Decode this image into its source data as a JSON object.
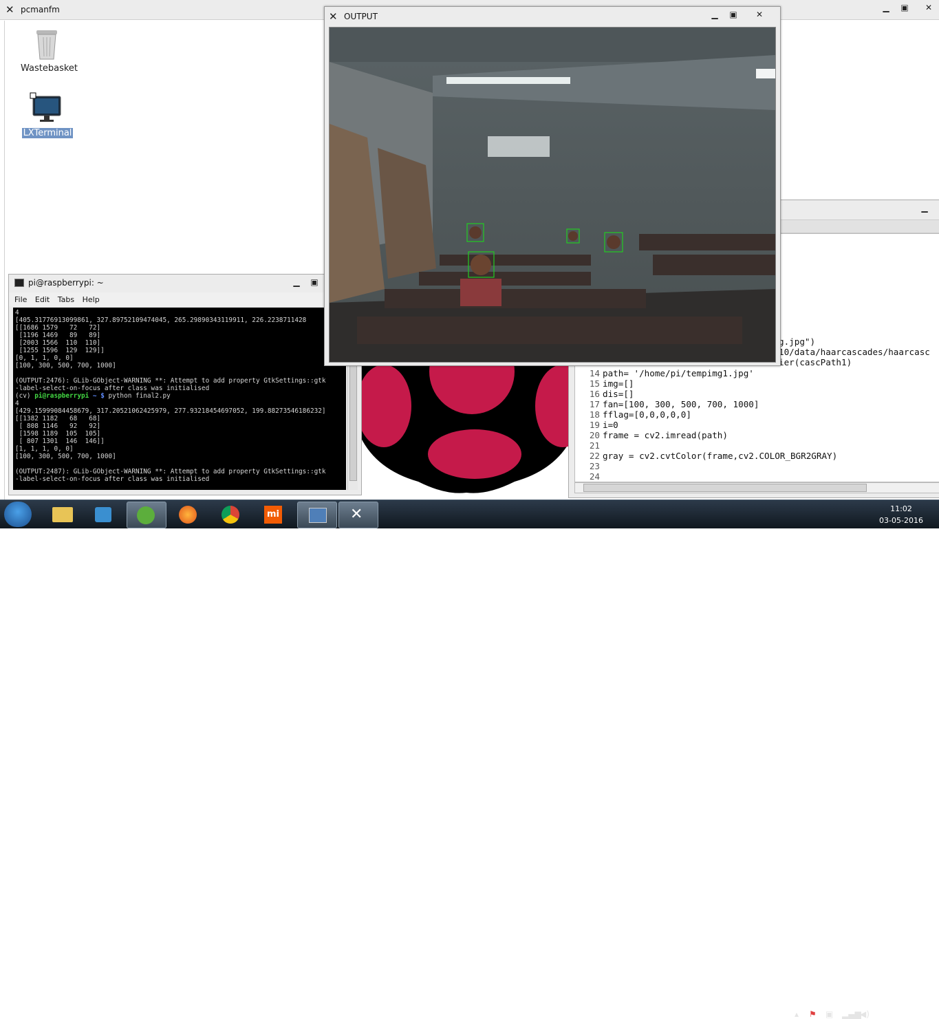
{
  "pcmanfm": {
    "title": "pcmanfm",
    "icons": [
      {
        "label": "Wastebasket"
      },
      {
        "label": "LXTerminal"
      }
    ]
  },
  "terminal": {
    "title": "pi@raspberrypi: ~",
    "menu": [
      "File",
      "Edit",
      "Tabs",
      "Help"
    ],
    "lines": [
      "4",
      "[405.31776913099861, 327.89752109474045, 265.29890343119911, 226.2238711428",
      "[[1686 1579   72   72]",
      " [1196 1469   89   89]",
      " [2003 1566  110  110]",
      " [1255 1596  129  129]]",
      "[0, 1, 1, 0, 0]",
      "[100, 300, 500, 700, 1000]",
      "",
      "(OUTPUT:2476): GLib-GObject-WARNING **: Attempt to add property GtkSettings::gtk",
      "-label-select-on-focus after class was initialised"
    ],
    "prompt_prefix": "(cv) ",
    "prompt_user": "pi@raspberrypi",
    "prompt_path": " ~ $",
    "prompt_cmd": " python final2.py",
    "lines2": [
      "4",
      "[429.15999084458679, 317.20521062425979, 277.93218454697052, 199.88273546186232]",
      "[[1382 1182   68   68]",
      " [ 808 1146   92   92]",
      " [1598 1189  105  105]",
      " [ 807 1301  146  146]]",
      "[1, 1, 1, 0, 0]",
      "[100, 300, 500, 700, 1000]",
      "",
      "(OUTPUT:2487): GLib-GObject-WARNING **: Attempt to add property GtkSettings::gtk",
      "-label-select-on-focus after class was initialised"
    ]
  },
  "editor": {
    "partial_lines": [
      {
        "text": "g.jpg\")"
      },
      {
        "text": "10/data/haarcascades/haarcasc"
      },
      {
        "text": "ier(cascPath1)"
      }
    ],
    "code": [
      {
        "num": "14",
        "text": "path= '/home/pi/tempimg1.jpg'"
      },
      {
        "num": "15",
        "text": "img=[]"
      },
      {
        "num": "16",
        "text": "dis=[]"
      },
      {
        "num": "17",
        "text": "fan=[100, 300, 500, 700, 1000]"
      },
      {
        "num": "18",
        "text": "fflag=[0,0,0,0,0]"
      },
      {
        "num": "19",
        "text": "i=0"
      },
      {
        "num": "20",
        "text": "frame = cv2.imread(path)"
      },
      {
        "num": "21",
        "text": ""
      },
      {
        "num": "22",
        "text": "gray = cv2.cvtColor(frame,cv2.COLOR_BGR2GRAY)"
      },
      {
        "num": "23",
        "text": ""
      },
      {
        "num": "24",
        "text": ""
      }
    ]
  },
  "output_window": {
    "title": "OUTPUT"
  },
  "taskbar": {
    "time": "11:02",
    "date": "03-05-2016",
    "apps": [
      "windows-start",
      "file-explorer",
      "media-player",
      "network-globe",
      "firefox",
      "chrome",
      "mi",
      "remote-desktop",
      "xming"
    ]
  },
  "colors": {
    "raspberry": "#c51a4a",
    "face_box": "#22cc22"
  }
}
